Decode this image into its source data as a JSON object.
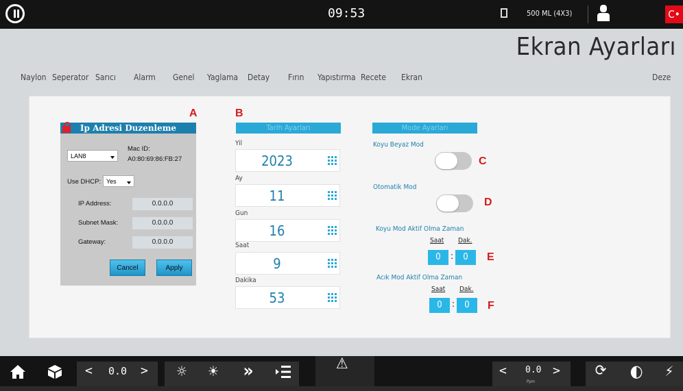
{
  "topbar": {
    "time": "09:53",
    "capacity": "500 ML (4X3)",
    "flag_symbol": "C•"
  },
  "header": {
    "title": "Ekran Ayarları",
    "tabs": [
      "Naylon",
      "Seperator",
      "Sarıcı",
      "Alarm",
      "Genel",
      "Yaglama",
      "Detay",
      "Fırın",
      "Yapıstırma",
      "Recete",
      "Ekran",
      "Deze"
    ],
    "active_tab": "Ekran"
  },
  "annotations": {
    "a": "A",
    "b": "B",
    "c": "C",
    "d": "D",
    "e": "E",
    "f": "F"
  },
  "ip_dialog": {
    "title": "Ip Adresi Duzenleme",
    "interface": "LAN8",
    "mac_label": "Mac ID:",
    "mac_value": "A0:80:69:86:FB:27",
    "dhcp_label": "Use DHCP:",
    "dhcp_value": "Yes",
    "ip_label": "IP Address:",
    "ip_value": "0.0.0.0",
    "subnet_label": "Subnet Mask:",
    "subnet_value": "0.0.0.0",
    "gateway_label": "Gateway:",
    "gateway_value": "0.0.0.0",
    "cancel": "Cancel",
    "apply": "Apply"
  },
  "date_settings": {
    "header": "Tarih Ayarları",
    "fields": [
      {
        "label": "Yil",
        "value": "2023"
      },
      {
        "label": "Ay",
        "value": "11"
      },
      {
        "label": "Gun",
        "value": "16"
      },
      {
        "label": "Saat",
        "value": "9"
      },
      {
        "label": "Dakika",
        "value": "53"
      }
    ]
  },
  "mode_settings": {
    "header": "Mode Ayarları",
    "dark_mode_label": "Koyu Beyaz Mod",
    "dark_mode_on": false,
    "auto_mode_label": "Otomatik Mod",
    "auto_mode_on": false,
    "dark_time_label": "Koyu Mod Aktif Olma Zaman",
    "light_time_label": "Acık Mod Aktif Olma Zaman",
    "hour_label": "Saat",
    "minute_label": "Dak.",
    "dark_hour": "0",
    "dark_minute": "0",
    "light_hour": "0",
    "light_minute": "0"
  },
  "bottombar": {
    "left_value": "0.0",
    "right_value": "0.0",
    "right_unit": "Ppm",
    "lt": "<",
    "gt": ">"
  }
}
